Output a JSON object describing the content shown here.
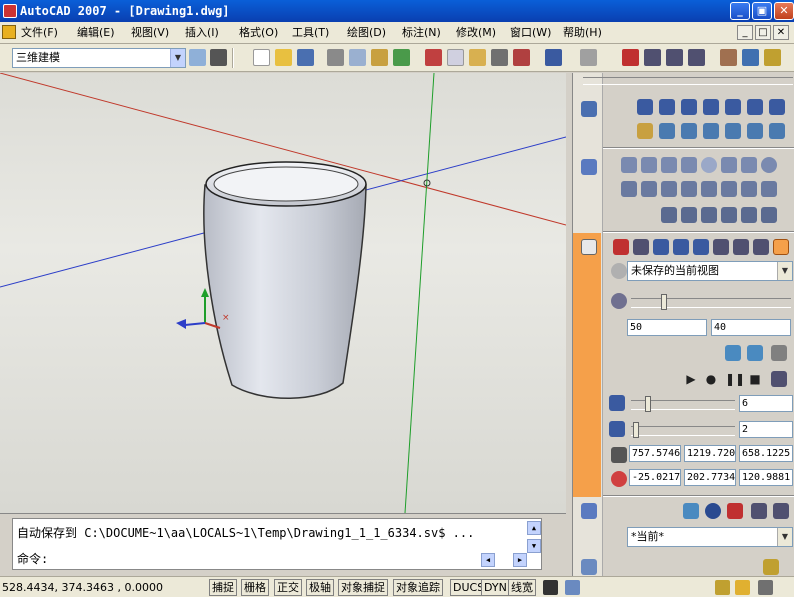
{
  "window": {
    "title": "AutoCAD 2007 - [Drawing1.dwg]",
    "min_icon": "minimize-icon",
    "max_icon": "maximize-icon",
    "close_icon": "close-icon"
  },
  "menu": {
    "items": [
      "文件(F)",
      "编辑(E)",
      "视图(V)",
      "插入(I)",
      "格式(O)",
      "工具(T)",
      "绘图(D)",
      "标注(N)",
      "修改(M)",
      "窗口(W)",
      "帮助(H)"
    ],
    "doc_controls": [
      "_",
      "□",
      "✕"
    ]
  },
  "toolbar": {
    "workspace": "三维建模"
  },
  "command": {
    "history": "自动保存到 C:\\DOCUME~1\\aa\\LOCALS~1\\Temp\\Drawing1_1_1_6334.sv$ ...",
    "prompt": "命令:"
  },
  "status": {
    "coords": "528.4434,  374.3463 , 0.0000",
    "toggles": [
      "捕捉",
      "栅格",
      "正交",
      "极轴",
      "对象捕捉",
      "对象追踪",
      "DUCS",
      "DYN",
      "线宽"
    ]
  },
  "palette": {
    "view_select": "未保存的当前视图",
    "lens_value": "50",
    "field_value": "40",
    "speed_value": "6",
    "step_value": "2",
    "camera": [
      "757.5746",
      "1219.7202",
      "658.1225"
    ],
    "target": [
      "-25.0217",
      "202.7734",
      "120.9881"
    ],
    "visual_style": "*当前*"
  },
  "colors": {
    "accent": "#0a46c8",
    "palette_strip": "#f5a04a",
    "x_axis": "#c0392b",
    "y_axis": "#1e9e2a",
    "z_axis": "#2c3ec8"
  }
}
